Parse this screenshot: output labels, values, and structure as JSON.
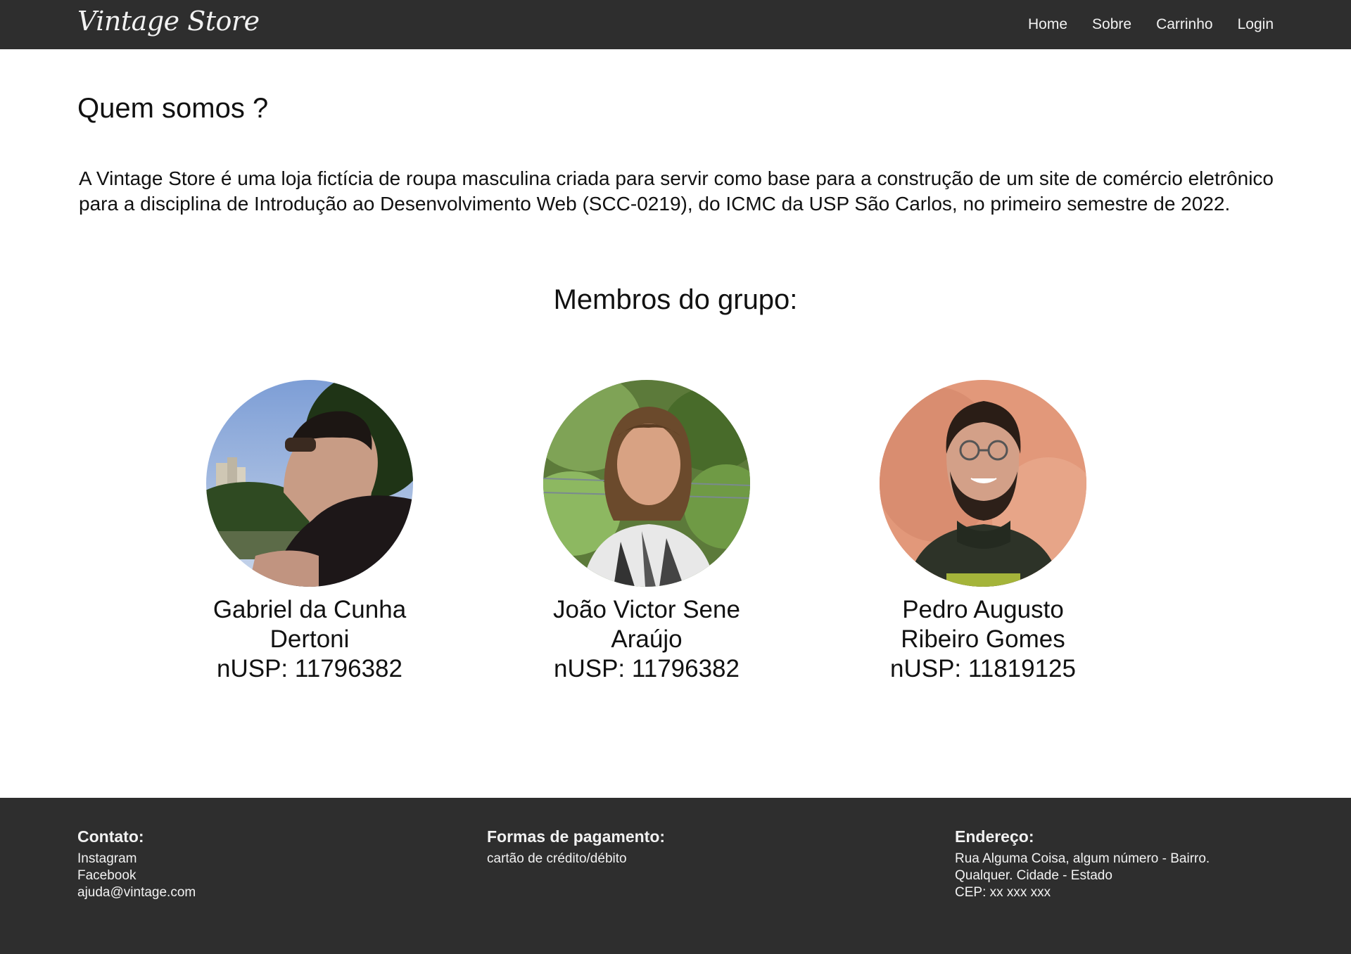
{
  "navbar": {
    "logo": "Vintage Store",
    "links": [
      "Home",
      "Sobre",
      "Carrinho",
      "Login"
    ]
  },
  "main": {
    "title": "Quem somos ?",
    "intro": "A Vintage Store é uma loja fictícia de roupa masculina criada para servir como base para a construção de um site de comércio eletrônico para a disciplina de Introdução ao Desenvolvimento Web (SCC-0219), do ICMC da USP São Carlos, no primeiro semestre de 2022.",
    "members_title": "Membros do grupo:",
    "members": [
      {
        "name_line1": "Gabriel da Cunha",
        "name_line2": "Dertoni",
        "nusp": "nUSP: 11796382"
      },
      {
        "name_line1": "João Victor Sene",
        "name_line2": "Araújo",
        "nusp": "nUSP: 11796382"
      },
      {
        "name_line1": "Pedro Augusto",
        "name_line2": "Ribeiro Gomes",
        "nusp": "nUSP: 11819125"
      }
    ]
  },
  "footer": {
    "contact": {
      "heading": "Contato:",
      "items": [
        "Instagram",
        "Facebook",
        "ajuda@vintage.com"
      ]
    },
    "payment": {
      "heading": "Formas de pagamento:",
      "items": [
        "cartão de crédito/débito"
      ]
    },
    "address": {
      "heading": "Endereço:",
      "items": [
        "Rua Alguma Coisa, algum número - Bairro.",
        "Qualquer. Cidade - Estado",
        "CEP: xx xxx xxx"
      ]
    }
  },
  "colors": {
    "bar_background": "#2e2e2e",
    "bar_text": "#f2f2f2",
    "body_text": "#111111"
  },
  "icons": [
    "avatar-photo-gabriel",
    "avatar-photo-joao",
    "avatar-photo-pedro"
  ]
}
